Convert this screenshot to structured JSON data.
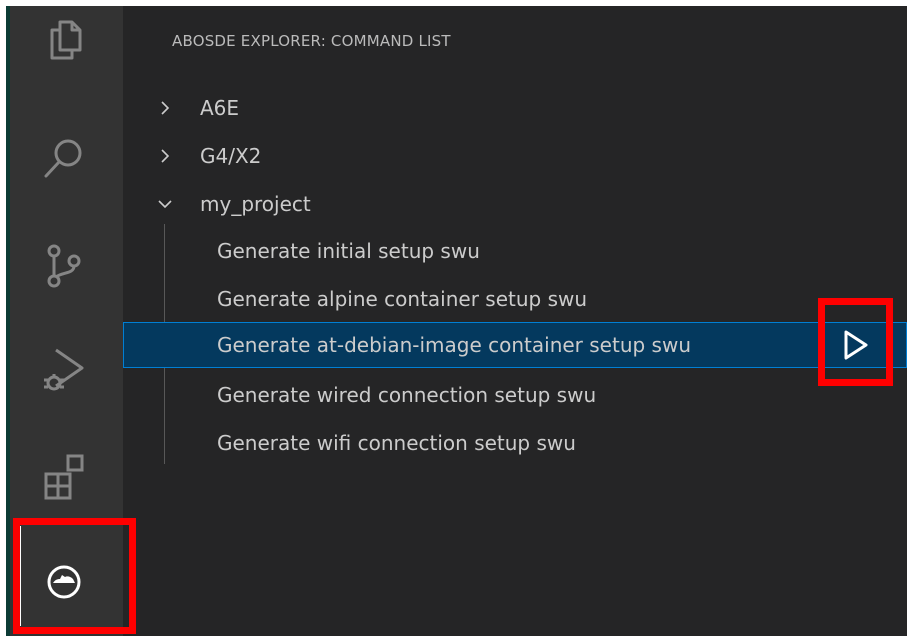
{
  "panel": {
    "title": "ABOSDE EXPLORER: COMMAND LIST"
  },
  "tree": {
    "groups": [
      {
        "label": "A6E",
        "expanded": false
      },
      {
        "label": "G4/X2",
        "expanded": false
      },
      {
        "label": "my_project",
        "expanded": true
      }
    ],
    "commands": [
      "Generate initial setup swu",
      "Generate alpine container setup swu",
      "Generate at-debian-image container setup swu",
      "Generate wired connection setup swu",
      "Generate wifi connection setup swu"
    ],
    "selected_command_index": 2
  },
  "activity_bar": [
    {
      "icon": "files-icon"
    },
    {
      "icon": "search-icon"
    },
    {
      "icon": "source-control-icon"
    },
    {
      "icon": "run-debug-icon"
    },
    {
      "icon": "extensions-icon"
    },
    {
      "icon": "abos-extension-icon",
      "active": true
    }
  ],
  "colors": {
    "sidebar_bg": "#252526",
    "activity_bar_bg": "#333333",
    "selection_bg": "#04395e",
    "selection_border": "#007fd4",
    "highlight": "#ff0000"
  }
}
